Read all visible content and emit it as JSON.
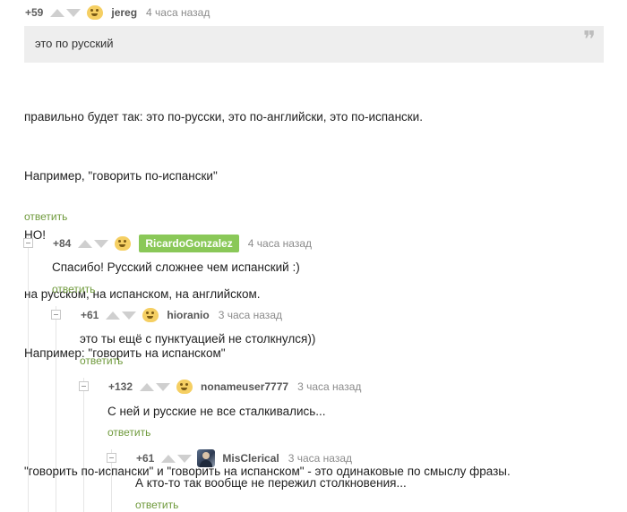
{
  "comments": [
    {
      "rating": "+59",
      "username": "jereg",
      "time": "4 часа назад",
      "avatar_icon": "emoji-face-icon",
      "quote": "это по русский",
      "quote_mark": "❞",
      "body": [
        "правильно будет так: это по-русски, это по-английски, это по-испански.",
        "Например, \"говорить по-испански\"",
        "НО!",
        "на русском, на испанском, на английском.",
        "Например: \"говорить на испанском\"",
        "",
        "\"говорить по-испански\" и \"говорить на испанском\" - это одинаковые по смыслу фразы."
      ],
      "reply_label": "ответить"
    },
    {
      "rating": "+84",
      "username": "RicardoGonzalez",
      "time": "4 часа назад",
      "avatar_icon": "emoji-face-icon",
      "body": "Спасибо! Русский сложнее чем испанский :)",
      "reply_label": "ответить"
    },
    {
      "rating": "+61",
      "username": "hioranio",
      "time": "3 часа назад",
      "avatar_icon": "emoji-face-icon",
      "body": "это ты ещё с пунктуацией не столкнулся))",
      "reply_label": "ответить"
    },
    {
      "rating": "+132",
      "username": "nonameuser7777",
      "time": "3 часа назад",
      "avatar_icon": "emoji-face-icon",
      "body": "С ней и русские не все сталкивались...",
      "reply_label": "ответить"
    },
    {
      "rating": "+61",
      "username": "MisClerical",
      "time": "3 часа назад",
      "avatar_icon": "user-photo-icon",
      "body": "А кто-то так вообще не пережил столкновения...",
      "reply_label": "ответить"
    }
  ],
  "colors": {
    "badge_green": "#8ac858",
    "reply_link": "#6f9a3c",
    "quote_bg": "#eeeeee"
  }
}
